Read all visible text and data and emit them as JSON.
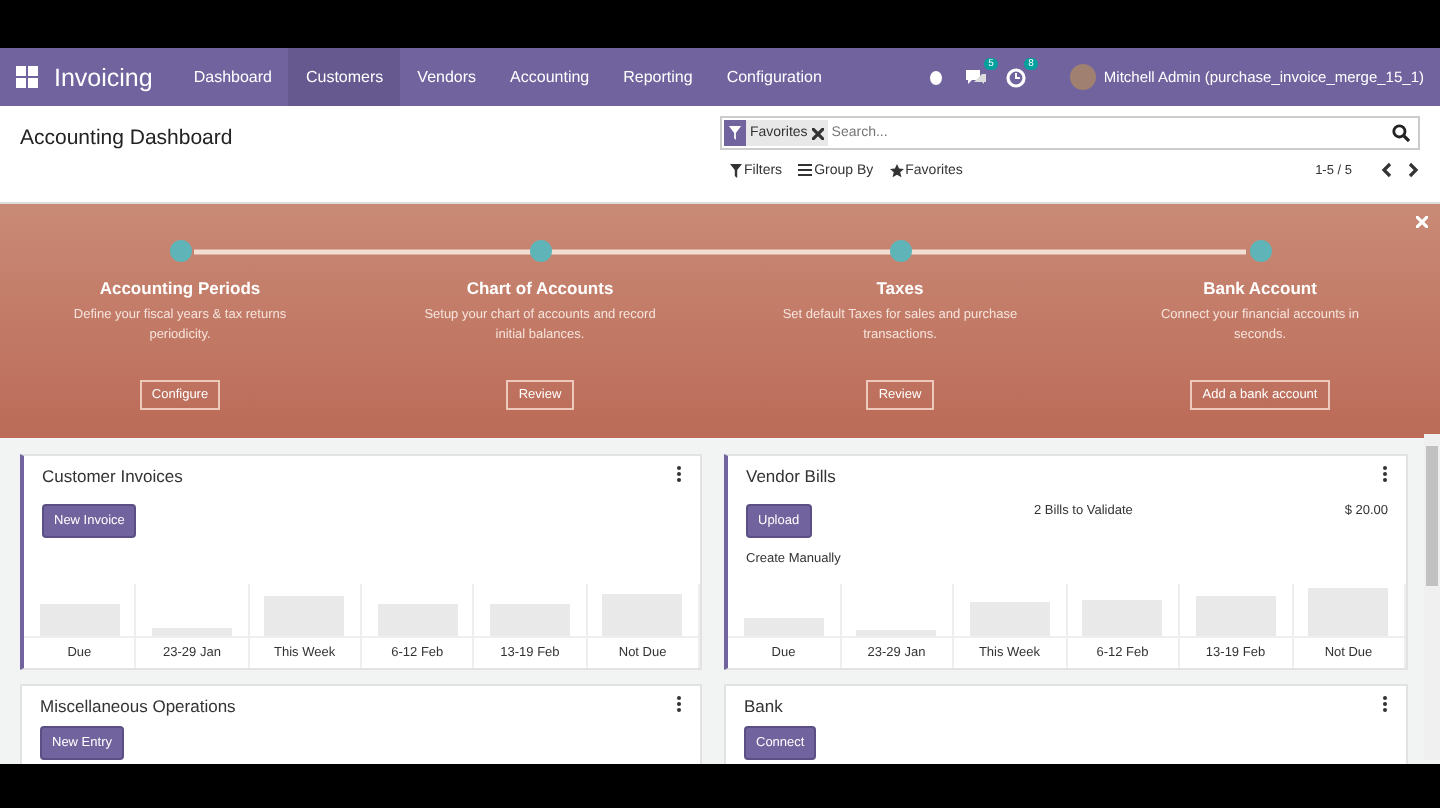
{
  "navbar": {
    "app_name": "Invoicing",
    "menu": [
      {
        "label": "Dashboard",
        "selected": false
      },
      {
        "label": "Customers",
        "selected": true
      },
      {
        "label": "Vendors",
        "selected": false
      },
      {
        "label": "Accounting",
        "selected": false
      },
      {
        "label": "Reporting",
        "selected": false
      },
      {
        "label": "Configuration",
        "selected": false
      }
    ],
    "messages_badge": "5",
    "activity_badge": "8",
    "user": "Mitchell Admin (purchase_invoice_merge_15_1)"
  },
  "control_panel": {
    "title": "Accounting Dashboard",
    "facet": "Favorites",
    "search": {
      "placeholder": "Search..."
    },
    "filters": "Filters",
    "group_by": "Group By",
    "favorites": "Favorites",
    "pager": "1-5 / 5"
  },
  "onboarding": {
    "steps": [
      {
        "title": "Accounting Periods",
        "description": "Define your fiscal years & tax returns periodicity.",
        "button": "Configure"
      },
      {
        "title": "Chart of Accounts",
        "description": "Setup your chart of accounts and record initial balances.",
        "button": "Review"
      },
      {
        "title": "Taxes",
        "description": "Set default Taxes for sales and purchase transactions.",
        "button": "Review"
      },
      {
        "title": "Bank Account",
        "description": "Connect your financial accounts in seconds.",
        "button": "Add a bank account"
      }
    ]
  },
  "journals": [
    {
      "title": "Customer Invoices",
      "button": "New Invoice",
      "graph": true,
      "categories": [
        "Due",
        "23-29 Jan",
        "This Week",
        "6-12 Feb",
        "13-19 Feb",
        "Not Due"
      ]
    },
    {
      "title": "Vendor Bills",
      "button": "Upload",
      "link": "Create Manually",
      "to_validate": "2 Bills to Validate",
      "amount": "$ 20.00",
      "graph": true,
      "categories": [
        "Due",
        "23-29 Jan",
        "This Week",
        "6-12 Feb",
        "13-19 Feb",
        "Not Due"
      ]
    },
    {
      "title": "Miscellaneous Operations",
      "button": "New Entry",
      "graph": false
    },
    {
      "title": "Bank",
      "button": "Connect",
      "graph": false
    }
  ]
}
